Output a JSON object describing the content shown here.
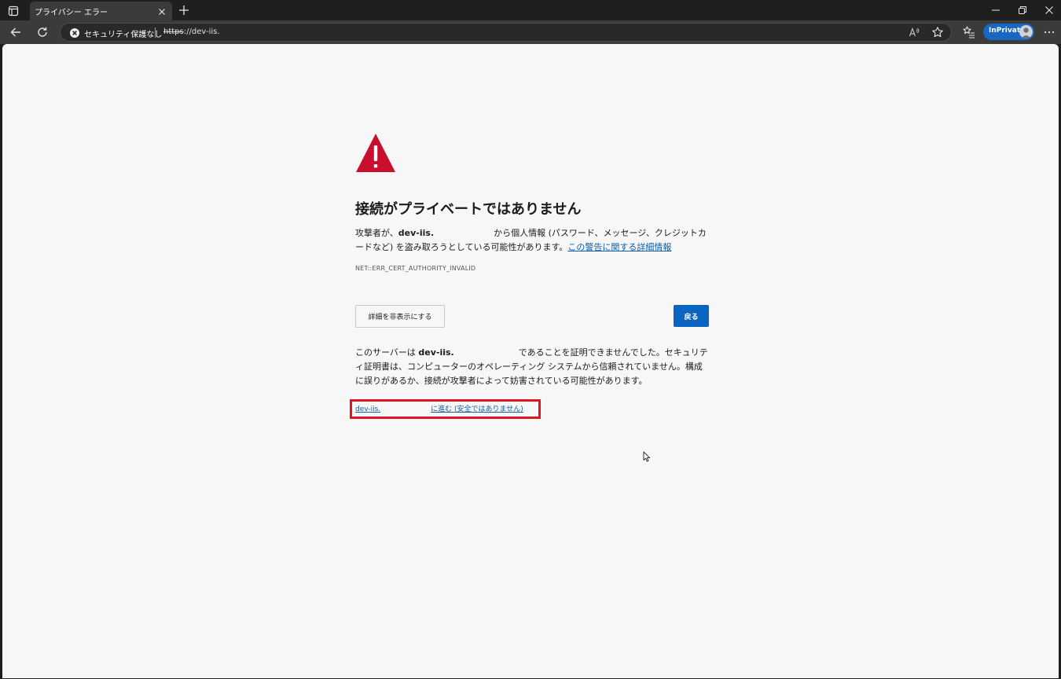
{
  "browser": {
    "tab": {
      "title": "プライバシー エラー"
    },
    "address": {
      "security_label": "セキュリティ保護なし",
      "url_scheme": "https",
      "url_rest": "://dev-iis."
    },
    "inprivate_label": "InPrivate"
  },
  "page": {
    "heading": "接続がプライベートではありません",
    "desc": {
      "prefix": "攻撃者が、",
      "host": "dev-iis.",
      "suffix": "から個人情報 (パスワード、メッセージ、クレジットカードなど) を盗み取ろうとしている可能性があります。",
      "learn_more": "この警告に関する詳細情報"
    },
    "error_code": "NET::ERR_CERT_AUTHORITY_INVALID",
    "hide_details_label": "詳細を非表示にする",
    "back_label": "戻る",
    "detail": {
      "prefix": "このサーバーは ",
      "host": "dev-iis.",
      "suffix": "であることを証明できませんでした。セキュリティ証明書は、コンピューターのオペレーティング システムから信頼されていません。構成に誤りがあるか、接続が攻撃者によって妨害されている可能性があります。"
    },
    "proceed": {
      "host": "dev-iis.",
      "label": "に進む (安全ではありません)"
    }
  },
  "colors": {
    "accent": "#0b63c2",
    "warning_red": "#c8102e",
    "highlight_box": "#e11522",
    "link": "#0e5ea8"
  },
  "icons": [
    "tab-actions-icon",
    "close-icon",
    "plus-icon",
    "minimize-icon",
    "restore-icon",
    "back-icon",
    "refresh-icon",
    "not-secure-icon",
    "read-aloud-icon",
    "favorite-icon",
    "favorites-icon",
    "more-icon",
    "warning-icon",
    "cursor-icon"
  ]
}
